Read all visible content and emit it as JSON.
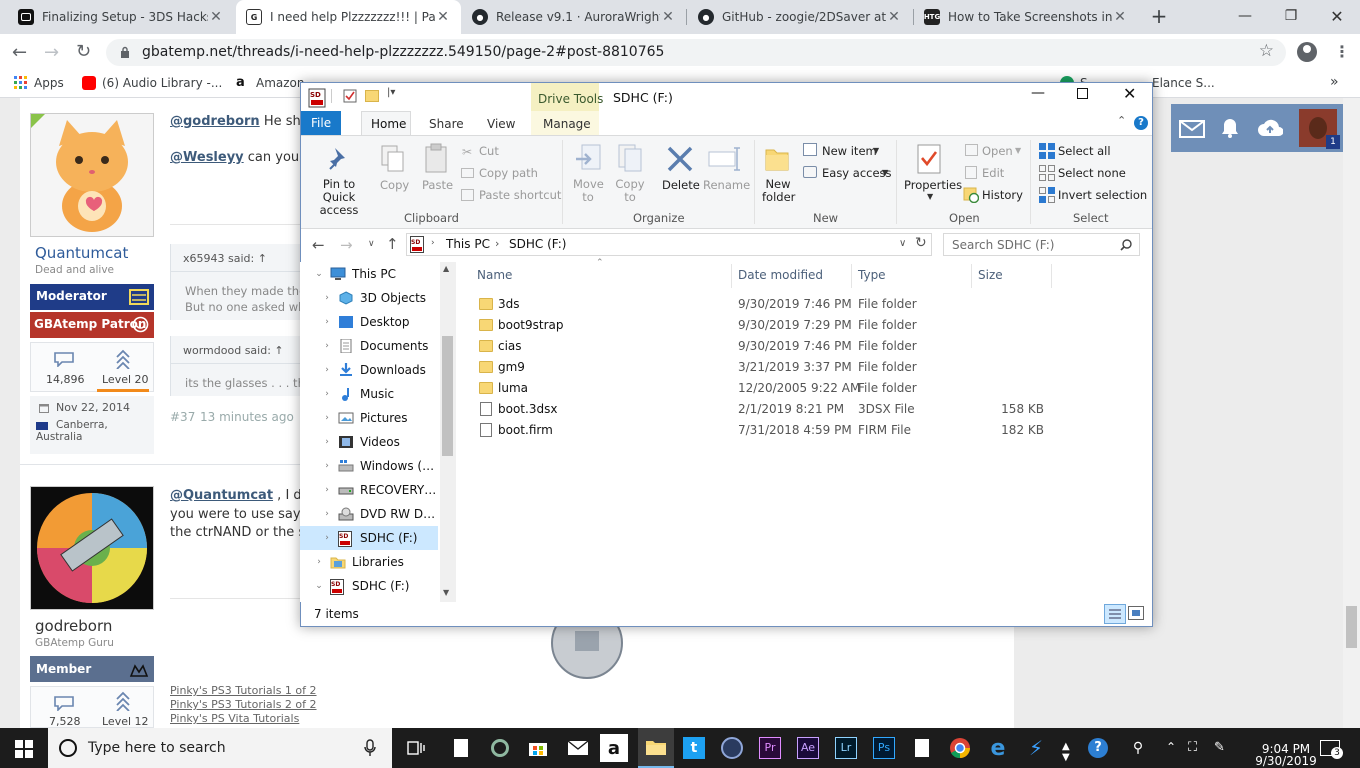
{
  "browser": {
    "tabs": [
      {
        "title": "Finalizing Setup - 3DS Hacks G",
        "icon": "generic-favicon",
        "color": "#111111"
      },
      {
        "title": "I need help Plzzzzzzz!!! | Page ",
        "icon": "gbatemp-favicon",
        "color": "#222222"
      },
      {
        "title": "Release v9.1 · AuroraWright/Lu",
        "icon": "github-favicon",
        "color": "#24292e"
      },
      {
        "title": "GitHub - zoogie/2DSaver at v1",
        "icon": "github-favicon",
        "color": "#24292e"
      },
      {
        "title": "How to Take Screenshots in W",
        "icon": "htg-favicon",
        "color": "#222222"
      }
    ],
    "url": "gbatemp.net/threads/i-need-help-plzzzzzzz.549150/page-2#post-8810765",
    "bookmarks": [
      {
        "label": "Apps",
        "icon": "apps-grid-icon",
        "color": "#4285f4"
      },
      {
        "label": "(6) Audio Library -...",
        "icon": "youtube-icon",
        "color": "#ff0000"
      },
      {
        "label": "Amazon...",
        "icon": "amazon-icon",
        "color": "#111111"
      }
    ],
    "bookmarks_partial": "S...",
    "bookmarks_partial2": "Elance S...",
    "bookmarks_more": "»"
  },
  "forum": {
    "post1": {
      "username": "Quantumcat",
      "user_title": "Dead and alive",
      "badge1": "Moderator",
      "badge1_color": "#1f3c88",
      "badge2": "GBAtemp Patron",
      "badge2_color": "#b5352a",
      "stat_messages": "14,896",
      "stat_level": "Level 20",
      "joined": "Nov 22, 2014",
      "location": "Canberra, Australia",
      "mention1": "@godreborn",
      "text1": " He sho",
      "mention2": "@Wesleyy",
      "text2": " can you u",
      "quote1_author": "x65943 said: ↑",
      "quote1_line1": "When they made the",
      "quote1_line2": "But no one asked wh",
      "quote2_author": "wormdood said: ↑",
      "quote2_line1": "its the glasses . . . the",
      "post_number": "#37",
      "post_time": "13 minutes ago"
    },
    "post2": {
      "username": "godreborn",
      "user_title": "GBAtemp Guru",
      "badge1": "Member",
      "badge1_color": "#5b6f8f",
      "stat_messages": "7,528",
      "stat_level": "Level 12",
      "mention": "@Quantumcat",
      "text_line1": " , I do",
      "text_line2": "you were to use say t",
      "text_line3": "the ctrNAND or the s",
      "sig1": "Pinky's PS3 Tutorials 1 of 2",
      "sig2": "Pinky's PS3 Tutorials 2 of 2",
      "sig3": "Pinky's PS Vita Tutorials"
    },
    "header_badge": "1"
  },
  "explorer": {
    "title": "SDHC (F:)",
    "tools_tab": "Drive Tools",
    "tabs": [
      "File",
      "Home",
      "Share",
      "View",
      "Manage"
    ],
    "ribbon": {
      "pin": "Pin to Quick access",
      "copy": "Copy",
      "paste": "Paste",
      "cut": "Cut",
      "copy_path": "Copy path",
      "paste_shortcut": "Paste shortcut",
      "move_to": "Move to",
      "copy_to": "Copy to",
      "delete": "Delete",
      "rename": "Rename",
      "new_folder": "New folder",
      "new_item": "New item",
      "easy_access": "Easy access",
      "properties": "Properties",
      "open": "Open",
      "edit": "Edit",
      "history": "History",
      "select_all": "Select all",
      "select_none": "Select none",
      "invert_selection": "Invert selection",
      "groups": [
        "Clipboard",
        "Organize",
        "New",
        "Open",
        "Select"
      ]
    },
    "breadcrumb": [
      "This PC",
      "SDHC (F:)"
    ],
    "search_placeholder": "Search SDHC (F:)",
    "nav": [
      {
        "label": "This PC",
        "icon": "this-pc-icon"
      },
      {
        "label": "3D Objects",
        "icon": "3d-objects-icon"
      },
      {
        "label": "Desktop",
        "icon": "desktop-icon"
      },
      {
        "label": "Documents",
        "icon": "documents-icon"
      },
      {
        "label": "Downloads",
        "icon": "downloads-icon"
      },
      {
        "label": "Music",
        "icon": "music-icon"
      },
      {
        "label": "Pictures",
        "icon": "pictures-icon"
      },
      {
        "label": "Videos",
        "icon": "videos-icon"
      },
      {
        "label": "Windows (C:)",
        "icon": "drive-c-icon"
      },
      {
        "label": "RECOVERY (D:)",
        "icon": "drive-d-icon"
      },
      {
        "label": "DVD RW Drive",
        "icon": "dvd-drive-icon"
      },
      {
        "label": "SDHC (F:)",
        "icon": "sd-card-icon"
      },
      {
        "label": "Libraries",
        "icon": "libraries-icon"
      },
      {
        "label": "SDHC (F:)",
        "icon": "sd-card-icon"
      }
    ],
    "columns": [
      "Name",
      "Date modified",
      "Type",
      "Size"
    ],
    "files": [
      {
        "name": "3ds",
        "date": "9/30/2019 7:46 PM",
        "type": "File folder",
        "size": "",
        "kind": "folder"
      },
      {
        "name": "boot9strap",
        "date": "9/30/2019 7:29 PM",
        "type": "File folder",
        "size": "",
        "kind": "folder"
      },
      {
        "name": "cias",
        "date": "9/30/2019 7:46 PM",
        "type": "File folder",
        "size": "",
        "kind": "folder"
      },
      {
        "name": "gm9",
        "date": "3/21/2019 3:37 PM",
        "type": "File folder",
        "size": "",
        "kind": "folder"
      },
      {
        "name": "luma",
        "date": "12/20/2005 9:22 AM",
        "type": "File folder",
        "size": "",
        "kind": "folder"
      },
      {
        "name": "boot.3dsx",
        "date": "2/1/2019 8:21 PM",
        "type": "3DSX File",
        "size": "158 KB",
        "kind": "file"
      },
      {
        "name": "boot.firm",
        "date": "7/31/2018 4:59 PM",
        "type": "FIRM File",
        "size": "182 KB",
        "kind": "file"
      }
    ],
    "status": "7 items"
  },
  "taskbar": {
    "search_placeholder": "Type here to search",
    "time": "9:04 PM",
    "date": "9/30/2019",
    "notification_count": "3"
  }
}
